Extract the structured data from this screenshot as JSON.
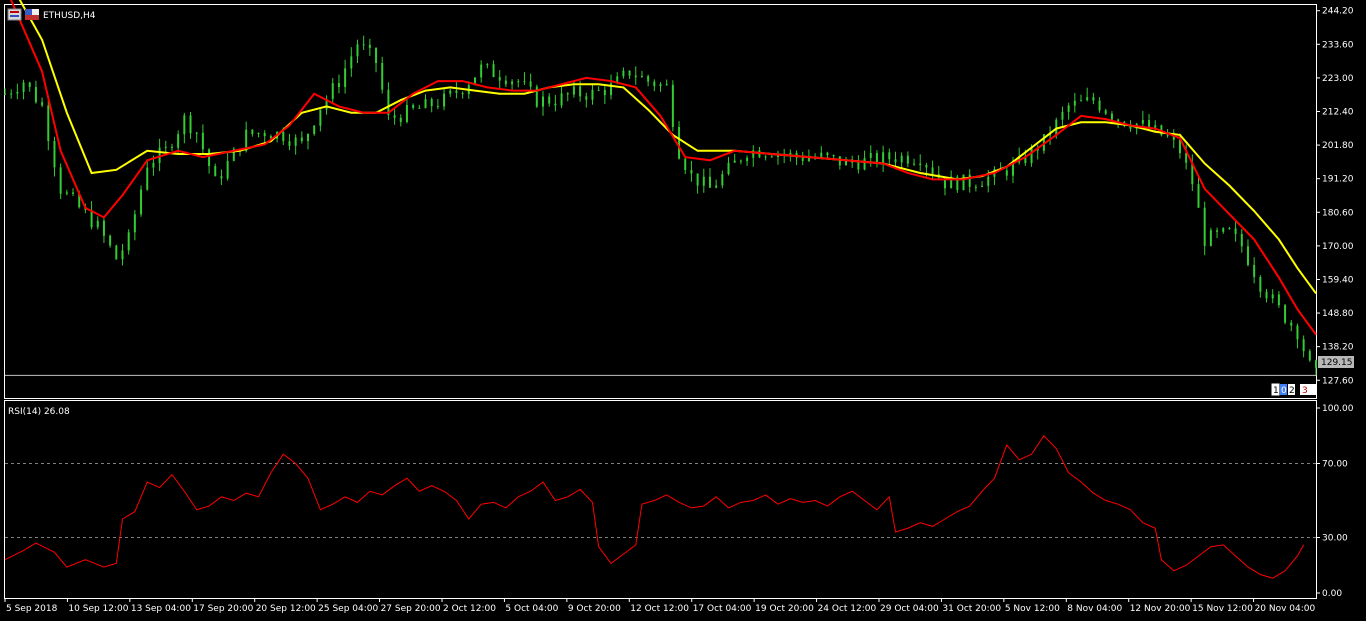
{
  "window": {
    "symbol_label": "ETHUSD,H4",
    "rsi_label": "RSI(14) 26.08",
    "current_price_label": "129.15",
    "price_tag_chars": [
      "1",
      "0",
      "2",
      "3"
    ]
  },
  "colors": {
    "background": "#000000",
    "frame": "#ffffff",
    "bull_candle": "#33cc33",
    "ma_fast": "#ff0000",
    "ma_slow": "#ffff00",
    "rsi_line": "#ff0000",
    "level_lines": "#808080",
    "price_line": "#c0c0c0"
  },
  "chart_data": [
    {
      "type": "candlestick",
      "title": "ETHUSD,H4",
      "ylim": [
        122.0,
        246.0
      ],
      "yticks": [
        244.2,
        233.6,
        223.0,
        212.4,
        201.8,
        191.2,
        180.6,
        170.0,
        159.4,
        148.8,
        138.2,
        127.6
      ],
      "ytick_labels": [
        "244.20",
        "233.60",
        "223.00",
        "212.40",
        "201.80",
        "191.20",
        "180.60",
        "170.00",
        "159.40",
        "148.80",
        "138.20",
        "127.60"
      ],
      "xtick_labels": [
        "5 Sep 2018",
        "10 Sep 12:00",
        "13 Sep 04:00",
        "17 Sep 20:00",
        "20 Sep 12:00",
        "25 Sep 04:00",
        "27 Sep 20:00",
        "2 Oct 12:00",
        "5 Oct 04:00",
        "9 Oct 20:00",
        "12 Oct 12:00",
        "17 Oct 04:00",
        "19 Oct 20:00",
        "24 Oct 12:00",
        "29 Oct 04:00",
        "31 Oct 20:00",
        "5 Nov 12:00",
        "8 Nov 04:00",
        "12 Nov 20:00",
        "15 Nov 12:00",
        "20 Nov 04:00"
      ],
      "current_price": 129.15,
      "close_path": [
        [
          0,
          218
        ],
        [
          3,
          222
        ],
        [
          6,
          214
        ],
        [
          9,
          188
        ],
        [
          12,
          182
        ],
        [
          15,
          176
        ],
        [
          18,
          166
        ],
        [
          20,
          172
        ],
        [
          23,
          196
        ],
        [
          26,
          200
        ],
        [
          29,
          210
        ],
        [
          31,
          206
        ],
        [
          34,
          190
        ],
        [
          36,
          196
        ],
        [
          39,
          205
        ],
        [
          42,
          206
        ],
        [
          45,
          205
        ],
        [
          48,
          202
        ],
        [
          51,
          214
        ],
        [
          54,
          222
        ],
        [
          57,
          234
        ],
        [
          60,
          228
        ],
        [
          62,
          210
        ],
        [
          65,
          212
        ],
        [
          68,
          214
        ],
        [
          71,
          216
        ],
        [
          74,
          220
        ],
        [
          77,
          226
        ],
        [
          80,
          224
        ],
        [
          83,
          222
        ],
        [
          86,
          216
        ],
        [
          89,
          216
        ],
        [
          92,
          218
        ],
        [
          95,
          218
        ],
        [
          98,
          220
        ],
        [
          101,
          225
        ],
        [
          104,
          222
        ],
        [
          107,
          220
        ],
        [
          109,
          200
        ],
        [
          111,
          192
        ],
        [
          114,
          188
        ],
        [
          117,
          194
        ],
        [
          120,
          200
        ],
        [
          124,
          200
        ],
        [
          128,
          198
        ],
        [
          132,
          198
        ],
        [
          136,
          196
        ],
        [
          140,
          197
        ],
        [
          144,
          198
        ],
        [
          148,
          198
        ],
        [
          152,
          190
        ],
        [
          156,
          190
        ],
        [
          160,
          192
        ],
        [
          164,
          196
        ],
        [
          168,
          203
        ],
        [
          172,
          214
        ],
        [
          176,
          216
        ],
        [
          180,
          210
        ],
        [
          184,
          208
        ],
        [
          188,
          204
        ],
        [
          190,
          200
        ],
        [
          192,
          190
        ],
        [
          194,
          172
        ],
        [
          198,
          174
        ],
        [
          200,
          170
        ],
        [
          203,
          158
        ],
        [
          206,
          150
        ],
        [
          209,
          143
        ],
        [
          211,
          132
        ],
        [
          212,
          129.15
        ]
      ],
      "series": [
        {
          "name": "",
          "color": "#ff0000",
          "path": [
            [
              0,
              252
            ],
            [
              6,
              225
            ],
            [
              9,
              200
            ],
            [
              13,
              182
            ],
            [
              16,
              179
            ],
            [
              19,
              186
            ],
            [
              23,
              197
            ],
            [
              28,
              200
            ],
            [
              32,
              198
            ],
            [
              37,
              200
            ],
            [
              42,
              202
            ],
            [
              46,
              208
            ],
            [
              50,
              218
            ],
            [
              54,
              214
            ],
            [
              58,
              212
            ],
            [
              62,
              212
            ],
            [
              66,
              218
            ],
            [
              70,
              222
            ],
            [
              74,
              222
            ],
            [
              78,
              220
            ],
            [
              82,
              219
            ],
            [
              86,
              219
            ],
            [
              90,
              221
            ],
            [
              94,
              223
            ],
            [
              98,
              222
            ],
            [
              102,
              220
            ],
            [
              106,
              211
            ],
            [
              110,
              198
            ],
            [
              114,
              197
            ],
            [
              118,
              200
            ],
            [
              124,
              199
            ],
            [
              130,
              198
            ],
            [
              136,
              197
            ],
            [
              142,
              196
            ],
            [
              146,
              193
            ],
            [
              150,
              191
            ],
            [
              155,
              191
            ],
            [
              160,
              193
            ],
            [
              165,
              198
            ],
            [
              170,
              205
            ],
            [
              174,
              211
            ],
            [
              178,
              210
            ],
            [
              182,
              208
            ],
            [
              186,
              207
            ],
            [
              190,
              204
            ],
            [
              194,
              188
            ],
            [
              198,
              180
            ],
            [
              202,
              172
            ],
            [
              206,
              160
            ],
            [
              209,
              150
            ],
            [
              212,
              142
            ]
          ]
        },
        {
          "name": "",
          "color": "#ffff00",
          "path": [
            [
              0,
              256
            ],
            [
              6,
              235
            ],
            [
              10,
              212
            ],
            [
              14,
              193
            ],
            [
              18,
              194
            ],
            [
              23,
              200
            ],
            [
              28,
              199
            ],
            [
              33,
              199
            ],
            [
              38,
              200
            ],
            [
              43,
              203
            ],
            [
              48,
              212
            ],
            [
              52,
              214
            ],
            [
              56,
              212
            ],
            [
              60,
              212
            ],
            [
              64,
              216
            ],
            [
              68,
              219
            ],
            [
              72,
              220
            ],
            [
              76,
              219
            ],
            [
              80,
              218
            ],
            [
              84,
              218
            ],
            [
              88,
              220
            ],
            [
              92,
              221
            ],
            [
              96,
              221
            ],
            [
              100,
              220
            ],
            [
              104,
              213
            ],
            [
              108,
              205
            ],
            [
              112,
              200
            ],
            [
              118,
              200
            ],
            [
              124,
              199
            ],
            [
              130,
              198
            ],
            [
              136,
              197
            ],
            [
              142,
              196
            ],
            [
              148,
              193
            ],
            [
              154,
              191
            ],
            [
              158,
              192
            ],
            [
              162,
              195
            ],
            [
              166,
              201
            ],
            [
              170,
              207
            ],
            [
              174,
              209
            ],
            [
              178,
              209
            ],
            [
              182,
              208
            ],
            [
              186,
              206
            ],
            [
              190,
              205
            ],
            [
              194,
              196
            ],
            [
              198,
              189
            ],
            [
              202,
              181
            ],
            [
              206,
              172
            ],
            [
              209,
              163
            ],
            [
              212,
              155
            ]
          ]
        }
      ]
    },
    {
      "type": "line",
      "title": "RSI(14) 26.08",
      "ylim": [
        0,
        100
      ],
      "yticks": [
        100,
        70,
        30,
        0
      ],
      "ytick_labels": [
        "100.00",
        "70.00",
        "30.00",
        "0.00"
      ],
      "levels": [
        70,
        30
      ],
      "series": [
        {
          "name": "RSI(14)",
          "color": "#ff0000",
          "path": [
            [
              0,
              18
            ],
            [
              3,
              23
            ],
            [
              5,
              27
            ],
            [
              8,
              22
            ],
            [
              10,
              14
            ],
            [
              13,
              18
            ],
            [
              16,
              14
            ],
            [
              18,
              16
            ],
            [
              19,
              40
            ],
            [
              21,
              44
            ],
            [
              23,
              60
            ],
            [
              25,
              57
            ],
            [
              27,
              64
            ],
            [
              29,
              55
            ],
            [
              31,
              45
            ],
            [
              33,
              47
            ],
            [
              35,
              52
            ],
            [
              37,
              50
            ],
            [
              39,
              54
            ],
            [
              41,
              52
            ],
            [
              43,
              65
            ],
            [
              45,
              75
            ],
            [
              47,
              70
            ],
            [
              49,
              62
            ],
            [
              51,
              45
            ],
            [
              53,
              48
            ],
            [
              55,
              52
            ],
            [
              57,
              49
            ],
            [
              59,
              55
            ],
            [
              61,
              53
            ],
            [
              63,
              58
            ],
            [
              65,
              62
            ],
            [
              67,
              55
            ],
            [
              69,
              58
            ],
            [
              71,
              55
            ],
            [
              73,
              50
            ],
            [
              75,
              40
            ],
            [
              77,
              48
            ],
            [
              79,
              49
            ],
            [
              81,
              46
            ],
            [
              83,
              52
            ],
            [
              85,
              55
            ],
            [
              87,
              60
            ],
            [
              89,
              50
            ],
            [
              91,
              52
            ],
            [
              93,
              56
            ],
            [
              95,
              49
            ],
            [
              96,
              25
            ],
            [
              98,
              16
            ],
            [
              100,
              21
            ],
            [
              102,
              26
            ],
            [
              103,
              48
            ],
            [
              105,
              50
            ],
            [
              107,
              53
            ],
            [
              109,
              49
            ],
            [
              111,
              46
            ],
            [
              113,
              47
            ],
            [
              115,
              52
            ],
            [
              117,
              46
            ],
            [
              119,
              49
            ],
            [
              121,
              50
            ],
            [
              123,
              53
            ],
            [
              125,
              48
            ],
            [
              127,
              51
            ],
            [
              129,
              49
            ],
            [
              131,
              50
            ],
            [
              133,
              47
            ],
            [
              135,
              52
            ],
            [
              137,
              55
            ],
            [
              139,
              50
            ],
            [
              141,
              45
            ],
            [
              143,
              52
            ],
            [
              144,
              33
            ],
            [
              146,
              35
            ],
            [
              148,
              38
            ],
            [
              150,
              36
            ],
            [
              152,
              40
            ],
            [
              154,
              44
            ],
            [
              156,
              47
            ],
            [
              158,
              55
            ],
            [
              160,
              62
            ],
            [
              162,
              80
            ],
            [
              164,
              72
            ],
            [
              166,
              75
            ],
            [
              168,
              85
            ],
            [
              170,
              78
            ],
            [
              172,
              65
            ],
            [
              174,
              60
            ],
            [
              176,
              54
            ],
            [
              178,
              50
            ],
            [
              180,
              48
            ],
            [
              182,
              45
            ],
            [
              184,
              38
            ],
            [
              186,
              35
            ],
            [
              187,
              18
            ],
            [
              189,
              12
            ],
            [
              191,
              15
            ],
            [
              193,
              20
            ],
            [
              195,
              25
            ],
            [
              197,
              26
            ],
            [
              199,
              20
            ],
            [
              201,
              14
            ],
            [
              203,
              10
            ],
            [
              205,
              8
            ],
            [
              207,
              12
            ],
            [
              209,
              20
            ],
            [
              210,
              26.08
            ]
          ]
        }
      ]
    }
  ]
}
